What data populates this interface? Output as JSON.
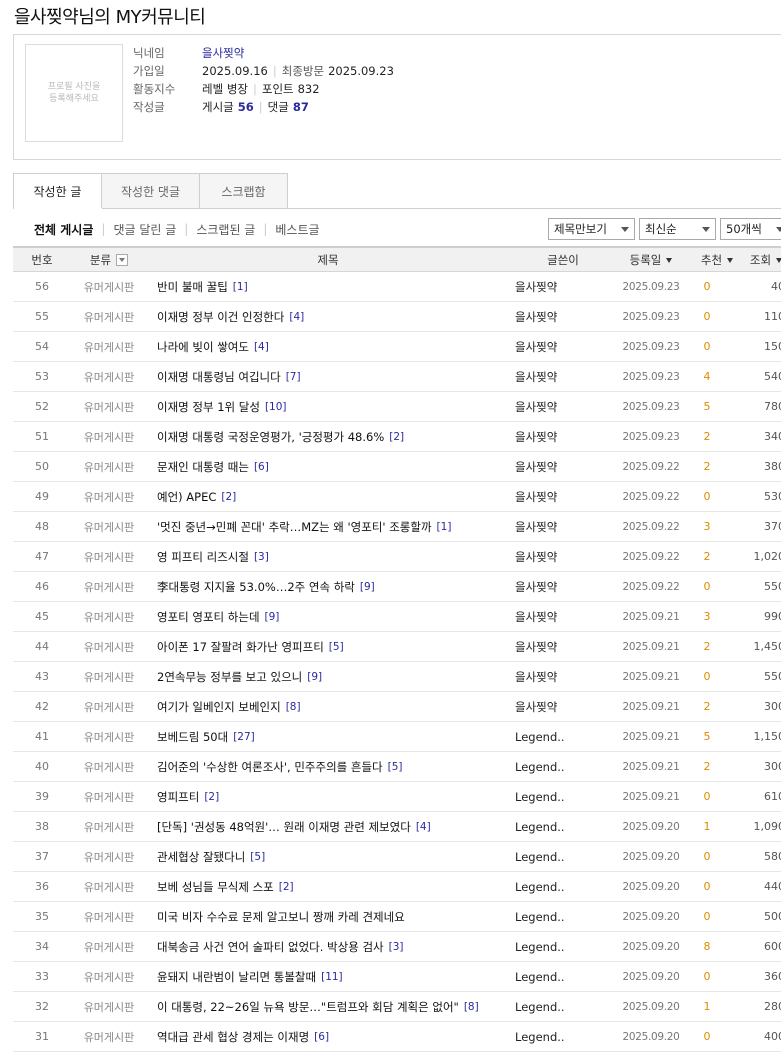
{
  "page": {
    "title": "을사찢약님의 MY커뮤니티"
  },
  "profile": {
    "photo_placeholder_line1": "프로필 사진을",
    "photo_placeholder_line2": "등록해주세요",
    "nickname_label": "닉네임",
    "nickname": "을사찢약",
    "join_label": "가입일",
    "join_date": "2025.09.16",
    "last_visit_label": "최종방문",
    "last_visit_date": "2025.09.23",
    "activity_label": "활동지수",
    "level_text": "레벨 병장",
    "point_label": "포인트",
    "point_value": "832",
    "posts_label": "작성글",
    "post_count_label": "게시글",
    "post_count": "56",
    "comment_count_label": "댓글",
    "comment_count": "87"
  },
  "tabs": [
    {
      "label": "작성한 글",
      "active": true
    },
    {
      "label": "작성한 댓글",
      "active": false
    },
    {
      "label": "스크랩함",
      "active": false
    }
  ],
  "subnav": [
    "전체 게시글",
    "댓글 달린 글",
    "스크랩된 글",
    "베스트글"
  ],
  "selects": {
    "view_mode": "제목만보기",
    "sort": "최신순",
    "page_size": "50개씩"
  },
  "table": {
    "headers": {
      "num": "번호",
      "category": "분류",
      "title": "제목",
      "author": "글쓴이",
      "date": "등록일",
      "recommend": "추천",
      "views": "조회"
    },
    "rows": [
      {
        "num": "56",
        "cat": "유머게시판",
        "title": "반미 불매 꿀팁",
        "cmt": "[1]",
        "author": "을사찢약",
        "date": "2025.09.23",
        "rec": "0",
        "views": "40"
      },
      {
        "num": "55",
        "cat": "유머게시판",
        "title": "이재명 정부 이건 인정한다",
        "cmt": "[4]",
        "author": "을사찢약",
        "date": "2025.09.23",
        "rec": "0",
        "views": "110"
      },
      {
        "num": "54",
        "cat": "유머게시판",
        "title": "나라에 빚이 쌓여도",
        "cmt": "[4]",
        "author": "을사찢약",
        "date": "2025.09.23",
        "rec": "0",
        "views": "150"
      },
      {
        "num": "53",
        "cat": "유머게시판",
        "title": "이재명 대통령님 여깁니다",
        "cmt": "[7]",
        "author": "을사찢약",
        "date": "2025.09.23",
        "rec": "4",
        "views": "540"
      },
      {
        "num": "52",
        "cat": "유머게시판",
        "title": "이재명 정부 1위 달성",
        "cmt": "[10]",
        "author": "을사찢약",
        "date": "2025.09.23",
        "rec": "5",
        "views": "780"
      },
      {
        "num": "51",
        "cat": "유머게시판",
        "title": "이재명 대통령 국정운영평가, '긍정평가 48.6%",
        "cmt": "[2]",
        "author": "을사찢약",
        "date": "2025.09.23",
        "rec": "2",
        "views": "340"
      },
      {
        "num": "50",
        "cat": "유머게시판",
        "title": "문재인 대통령 때는",
        "cmt": "[6]",
        "author": "을사찢약",
        "date": "2025.09.22",
        "rec": "2",
        "views": "380"
      },
      {
        "num": "49",
        "cat": "유머게시판",
        "title": "예언) APEC",
        "cmt": "[2]",
        "author": "을사찢약",
        "date": "2025.09.22",
        "rec": "0",
        "views": "530"
      },
      {
        "num": "48",
        "cat": "유머게시판",
        "title": "'멋진 중년→민폐 꼰대' 추락…MZ는 왜 '영포티' 조롱할까",
        "cmt": "[1]",
        "author": "을사찢약",
        "date": "2025.09.22",
        "rec": "3",
        "views": "370"
      },
      {
        "num": "47",
        "cat": "유머게시판",
        "title": "영 피프티 리즈시절",
        "cmt": "[3]",
        "author": "을사찢약",
        "date": "2025.09.22",
        "rec": "2",
        "views": "1,020"
      },
      {
        "num": "46",
        "cat": "유머게시판",
        "title": "李대통령 지지율 53.0%…2주 연속 하락",
        "cmt": "[9]",
        "author": "을사찢약",
        "date": "2025.09.22",
        "rec": "0",
        "views": "550"
      },
      {
        "num": "45",
        "cat": "유머게시판",
        "title": "영포티 영포티 하는데",
        "cmt": "[9]",
        "author": "을사찢약",
        "date": "2025.09.21",
        "rec": "3",
        "views": "990"
      },
      {
        "num": "44",
        "cat": "유머게시판",
        "title": "아이폰 17 잘팔려 화가난 영피프티",
        "cmt": "[5]",
        "author": "을사찢약",
        "date": "2025.09.21",
        "rec": "2",
        "views": "1,450"
      },
      {
        "num": "43",
        "cat": "유머게시판",
        "title": "2연속무능 정부를 보고 있으니",
        "cmt": "[9]",
        "author": "을사찢약",
        "date": "2025.09.21",
        "rec": "0",
        "views": "550"
      },
      {
        "num": "42",
        "cat": "유머게시판",
        "title": "여기가 일베인지 보베인지",
        "cmt": "[8]",
        "author": "을사찢약",
        "date": "2025.09.21",
        "rec": "2",
        "views": "300"
      },
      {
        "num": "41",
        "cat": "유머게시판",
        "title": "보베드림 50대",
        "cmt": "[27]",
        "author": "Legend..",
        "date": "2025.09.21",
        "rec": "5",
        "views": "1,150"
      },
      {
        "num": "40",
        "cat": "유머게시판",
        "title": "김어준의 '수상한 여론조사', 민주주의를 흔들다",
        "cmt": "[5]",
        "author": "Legend..",
        "date": "2025.09.21",
        "rec": "2",
        "views": "300"
      },
      {
        "num": "39",
        "cat": "유머게시판",
        "title": "영피프티",
        "cmt": "[2]",
        "author": "Legend..",
        "date": "2025.09.21",
        "rec": "0",
        "views": "610"
      },
      {
        "num": "38",
        "cat": "유머게시판",
        "title": "[단독] '권성동 48억원'… 원래 이재명 관련 제보였다",
        "cmt": "[4]",
        "author": "Legend..",
        "date": "2025.09.20",
        "rec": "1",
        "views": "1,090"
      },
      {
        "num": "37",
        "cat": "유머게시판",
        "title": "관세협상 잘됐다니",
        "cmt": "[5]",
        "author": "Legend..",
        "date": "2025.09.20",
        "rec": "0",
        "views": "580"
      },
      {
        "num": "36",
        "cat": "유머게시판",
        "title": "보베 성님들 무식제 스포",
        "cmt": "[2]",
        "author": "Legend..",
        "date": "2025.09.20",
        "rec": "0",
        "views": "440"
      },
      {
        "num": "35",
        "cat": "유머게시판",
        "title": "미국 비자 수수료 문제 알고보니 짱깨 카레 견제네요",
        "cmt": "",
        "author": "Legend..",
        "date": "2025.09.20",
        "rec": "0",
        "views": "500"
      },
      {
        "num": "34",
        "cat": "유머게시판",
        "title": "대북송금 사건 연어 술파티 없었다. 박상용 검사",
        "cmt": "[3]",
        "author": "Legend..",
        "date": "2025.09.20",
        "rec": "8",
        "views": "600"
      },
      {
        "num": "33",
        "cat": "유머게시판",
        "title": "윤돼지 내란범이 날리면 통볼찰때",
        "cmt": "[11]",
        "author": "Legend..",
        "date": "2025.09.20",
        "rec": "0",
        "views": "360"
      },
      {
        "num": "32",
        "cat": "유머게시판",
        "title": "이 대통령, 22~26일 뉴욕 방문…\"트럼프와 회담 계획은 없어\"",
        "cmt": "[8]",
        "author": "Legend..",
        "date": "2025.09.20",
        "rec": "1",
        "views": "280"
      },
      {
        "num": "31",
        "cat": "유머게시판",
        "title": "역대급 관세 협상 경제는 이재명",
        "cmt": "[6]",
        "author": "Legend..",
        "date": "2025.09.20",
        "rec": "0",
        "views": "400"
      }
    ]
  }
}
